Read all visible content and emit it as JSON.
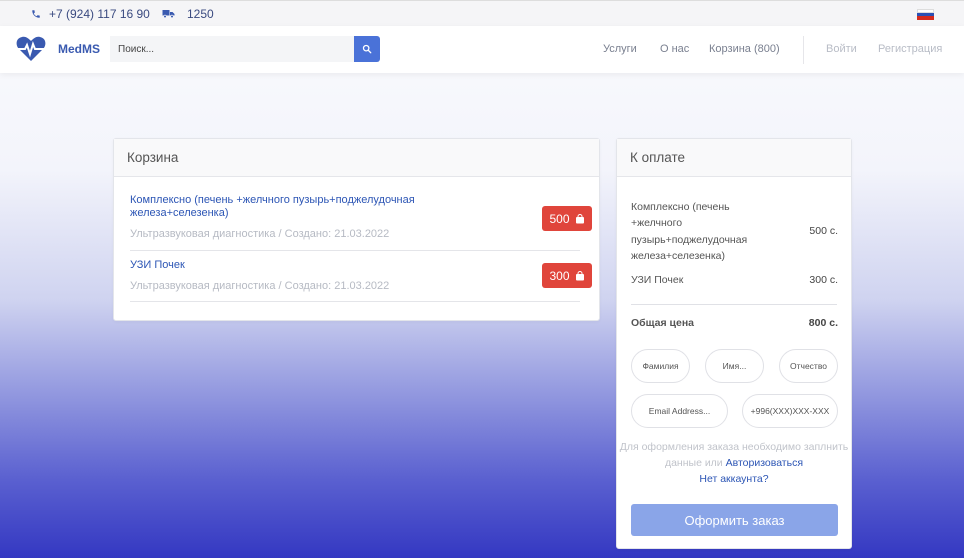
{
  "topbar": {
    "phone": "+7 (924) 117 16 90",
    "delivery_count": "1250",
    "language_flag": "ru",
    "colors": {
      "flag_white": "#ffffff",
      "flag_blue": "#2b50b5",
      "flag_red": "#d52b1e"
    }
  },
  "navbar": {
    "logo_text": "MedMS",
    "search_placeholder": "Поиск...",
    "links": {
      "services": "Услуги",
      "about": "О нас",
      "cart": "Корзина (800)",
      "login": "Войти",
      "register": "Регистрация"
    }
  },
  "cart": {
    "title": "Корзина",
    "items": [
      {
        "title": "Комплексно (печень +желчного пузырь+поджелудочная железа+селезенка)",
        "meta": "Ультразвуковая диагностика / Создано: 21.03.2022",
        "price": "500"
      },
      {
        "title": "УЗИ Почек",
        "meta": "Ультразвуковая диагностика / Создано: 21.03.2022",
        "price": "300"
      }
    ]
  },
  "summary": {
    "title": "К оплате",
    "items": [
      {
        "name": "Комплексно (печень +желчного пузырь+поджелудочная железа+селезенка)",
        "price": "500 с."
      },
      {
        "name": "УЗИ Почек",
        "price": "300 с."
      }
    ],
    "total_label": "Общая цена",
    "total_value": "800 с.",
    "form": {
      "last_name_placeholder": "Фамилия",
      "first_name_placeholder": "Имя...",
      "patronymic_placeholder": "Отчество",
      "email_placeholder": "Email Address...",
      "phone_placeholder": "+996(XXX)XXX-XXX"
    },
    "info_text": "Для оформления заказа необходимо заплнить данные или",
    "login_link": "Авторизоваться",
    "no_account_link": "Нет аккаунта?",
    "submit_label": "Оформить заказ"
  }
}
